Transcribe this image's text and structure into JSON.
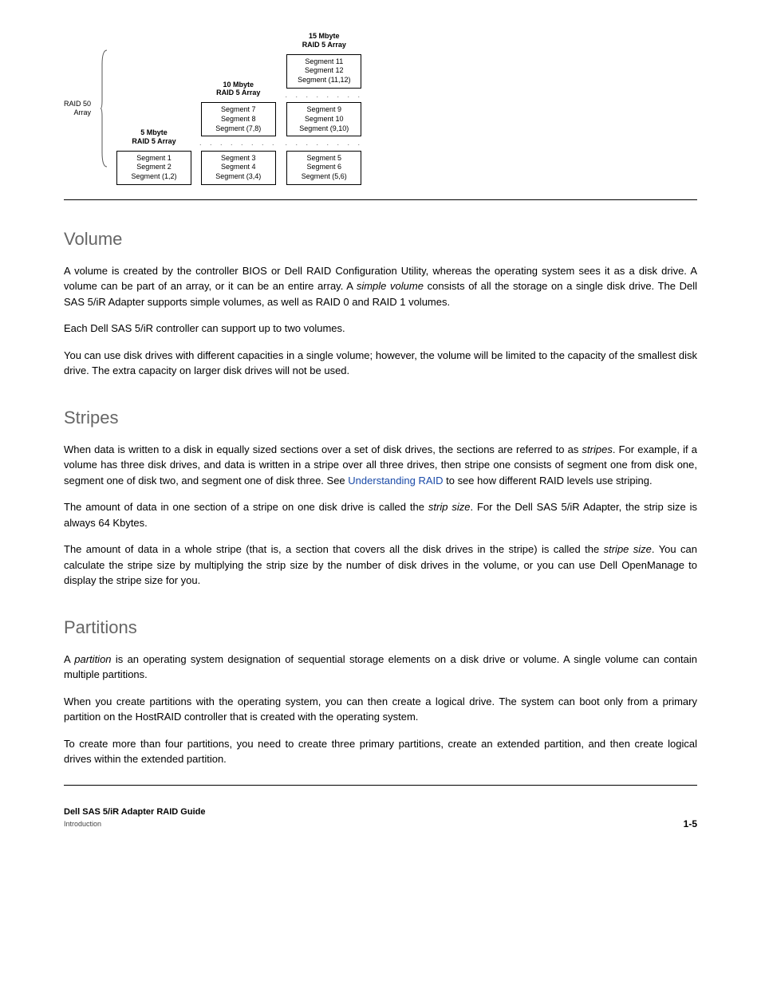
{
  "figure": {
    "side_label_l1": "RAID 50",
    "side_label_l2": "Array",
    "col1": {
      "header_l1": "5 Mbyte",
      "header_l2": "RAID 5 Array",
      "box1_l1": "Segment 1",
      "box1_l2": "Segment 2",
      "box1_l3": "Segment (1,2)"
    },
    "col2": {
      "header_l1": "10 Mbyte",
      "header_l2": "RAID 5 Array",
      "box1_l1": "Segment 7",
      "box1_l2": "Segment 8",
      "box1_l3": "Segment (7,8)",
      "box2_l1": "Segment 3",
      "box2_l2": "Segment 4",
      "box2_l3": "Segment (3,4)"
    },
    "col3": {
      "header_l1": "15 Mbyte",
      "header_l2": "RAID 5 Array",
      "box1_l1": "Segment 11",
      "box1_l2": "Segment 12",
      "box1_l3": "Segment (11,12)",
      "box2_l1": "Segment 9",
      "box2_l2": "Segment 10",
      "box2_l3": "Segment (9,10)",
      "box3_l1": "Segment 5",
      "box3_l2": "Segment 6",
      "box3_l3": "Segment (5,6)"
    },
    "dots": ". . . . . . . ."
  },
  "s1": {
    "title": "Volume",
    "p1a": "A volume is created by the controller BIOS or Dell RAID Configuration Utility, whereas the operating system sees it as a disk drive. A volume can be part of an array, or it can be an entire array. A ",
    "p1b": "simple volume",
    "p1c": " consists of all the storage on a single disk drive. The Dell SAS 5/iR Adapter supports simple volumes, as well as RAID 0 and RAID 1 volumes.",
    "p2": "Each Dell SAS 5/iR controller can support up to two volumes.",
    "p3": "You can use disk drives with different capacities in a single volume; however, the volume will be limited to the capacity of the smallest disk drive. The extra capacity on larger disk drives will not be used."
  },
  "s2": {
    "title": "Stripes",
    "p1a": "When data is written to a disk in equally sized sections over a set of disk drives, the sections are referred to as ",
    "p1b": "stripes",
    "p1c": ". For example, if a volume has three disk drives, and data is written in a stripe over all three drives, then stripe one consists of segment one from disk one, segment one of disk two, and segment one of disk three. See ",
    "link": "Understanding RAID",
    "p1d": " to see how different RAID levels use striping.",
    "p2a": "The amount of data in one section of a stripe on one disk drive is called the ",
    "p2b": "strip size",
    "p2c": ". For the Dell SAS 5/iR Adapter, the strip size is always 64 Kbytes.",
    "p3a": "The amount of data in a whole stripe (that is, a section that covers all the disk drives in the stripe) is called the ",
    "p3b": "stripe size",
    "p3c": ". You can calculate the stripe size by multiplying the strip size by the number of disk drives in the volume, or you can use Dell OpenManage to display the stripe size for you."
  },
  "s3": {
    "title": "Partitions",
    "p1a": "A ",
    "p1b": "partition",
    "p1c": " is an operating system designation of sequential storage elements on a disk drive or volume. A single volume can contain multiple partitions.",
    "p2": "When you create partitions with the operating system, you can then create a logical drive. The system can boot only from a primary partition on the HostRAID controller that is created with the operating system.",
    "p3": "To create more than four partitions, you need to create three primary partitions, create an extended partition, and then create logical drives within the extended partition."
  },
  "footer": {
    "left_l1": "Dell SAS 5/iR Adapter RAID Guide",
    "left_l2": "Introduction",
    "right": "1-5"
  }
}
